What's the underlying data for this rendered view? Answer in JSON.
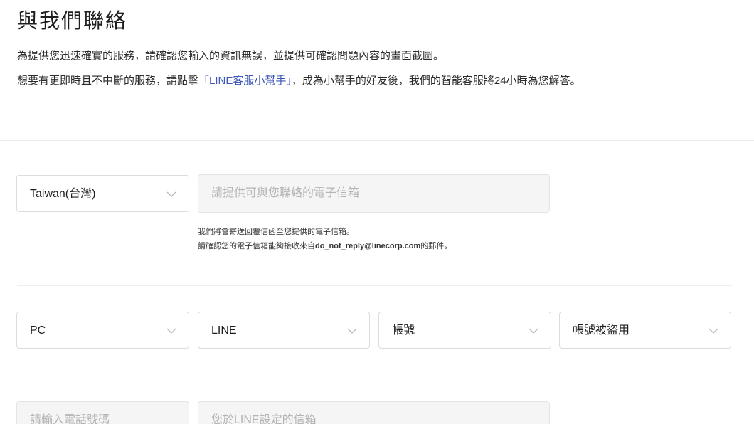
{
  "header": {
    "title": "與我們聯絡"
  },
  "intro": {
    "line1": "為提供您迅速確實的服務，請確認您輸入的資訊無誤，並提供可確認問題內容的畫面截圖。",
    "line2_before": "想要有更即時且不中斷的服務，請點擊",
    "line2_link": "「LINE客服小幫手」",
    "line2_after": "，成為小幫手的好友後，我們的智能客服將24小時為您解答。"
  },
  "form": {
    "country": {
      "selected": "Taiwan(台灣)"
    },
    "email": {
      "placeholder": "請提供可與您聯絡的電子信箱",
      "value": ""
    },
    "email_hint": {
      "line1": "我們將會寄送回覆信函至您提供的電子信箱。",
      "line2_before": "請確認您的電子信箱能夠接收來自",
      "line2_email": "do_not_reply@linecorp.com",
      "line2_after": "的郵件。"
    },
    "device": {
      "selected": "PC"
    },
    "service": {
      "selected": "LINE"
    },
    "category": {
      "selected": "帳號"
    },
    "subcategory": {
      "selected": "帳號被盜用"
    },
    "phone": {
      "placeholder": "請輸入電話號碼",
      "value": ""
    },
    "line_email": {
      "placeholder": "您於LINE設定的信箱",
      "value": ""
    }
  },
  "icons": {
    "dropdown": "chevron-down-icon"
  },
  "colors": {
    "link": "#3c55b8",
    "input_bg": "#f5f5f5",
    "border": "#dcdcdc",
    "placeholder": "#b4b4b4"
  }
}
